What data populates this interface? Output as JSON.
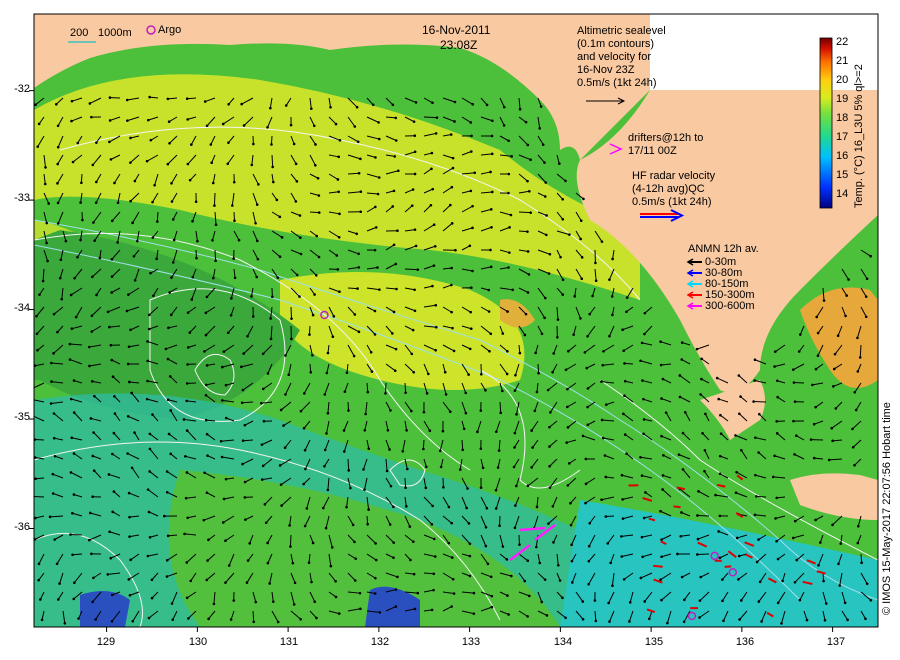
{
  "title": {
    "date": "16-Nov-2011",
    "time": "23:08Z"
  },
  "scale_legend": {
    "depth_a": "200",
    "depth_b": "1000m",
    "argo": "Argo"
  },
  "altimetry_note": {
    "lines": [
      "Altimetric sealevel",
      "(0.1m contours)",
      "and velocity for",
      "16-Nov 23Z",
      "0.5m/s (1kt 24h)"
    ]
  },
  "drifters_note": {
    "line1": "drifters@12h to",
    "line2": "17/11 00Z"
  },
  "hf_radar_note": {
    "lines": [
      "HF radar velocity",
      "(4-12h avg)QC",
      "0.5m/s (1kt 24h)"
    ]
  },
  "anmn_legend": {
    "title": "ANMN 12h av.",
    "items": [
      {
        "label": "0-30m",
        "color": "#000000"
      },
      {
        "label": "30-80m",
        "color": "#0000ff"
      },
      {
        "label": "80-150m",
        "color": "#00d8ff"
      },
      {
        "label": "150-300m",
        "color": "#ff0000"
      },
      {
        "label": "300-600m",
        "color": "#ff00ff"
      }
    ]
  },
  "colorbar": {
    "title": "Temp. (°C) 16_L3U 5% ql>=2",
    "ticks": [
      "22",
      "21",
      "20",
      "19",
      "18",
      "17",
      "16",
      "15",
      "14"
    ],
    "min": 13.2,
    "max": 22
  },
  "axes": {
    "x_ticks": [
      "129",
      "130",
      "131",
      "132",
      "133",
      "134",
      "135",
      "136",
      "137"
    ],
    "y_ticks": [
      "-32",
      "-33",
      "-34",
      "-35",
      "-36"
    ],
    "lon_range": [
      128.2,
      137.5
    ],
    "lat_range": [
      -36.9,
      -31.3
    ]
  },
  "credit": "© IMOS 15-May-2017 22:07:56 Hobart time",
  "colors": {
    "land": "#f9c9a1",
    "warm": "#e8b030",
    "yellow": "#d6e62a",
    "green": "#5ec83a",
    "cyan": "#35c2b8",
    "blue": "#1e3cb4",
    "arrow_black": "#000000",
    "arrow_red": "#e00000",
    "arrow_magenta": "#ff20ff",
    "argo": "#c020c0"
  },
  "argo_floats": [
    {
      "lon": 129.55,
      "lat": -31.85
    },
    {
      "lon": 131.4,
      "lat": -34.05
    },
    {
      "lon": 135.7,
      "lat": -36.25
    },
    {
      "lon": 135.9,
      "lat": -36.4
    },
    {
      "lon": 135.45,
      "lat": -36.8
    }
  ]
}
